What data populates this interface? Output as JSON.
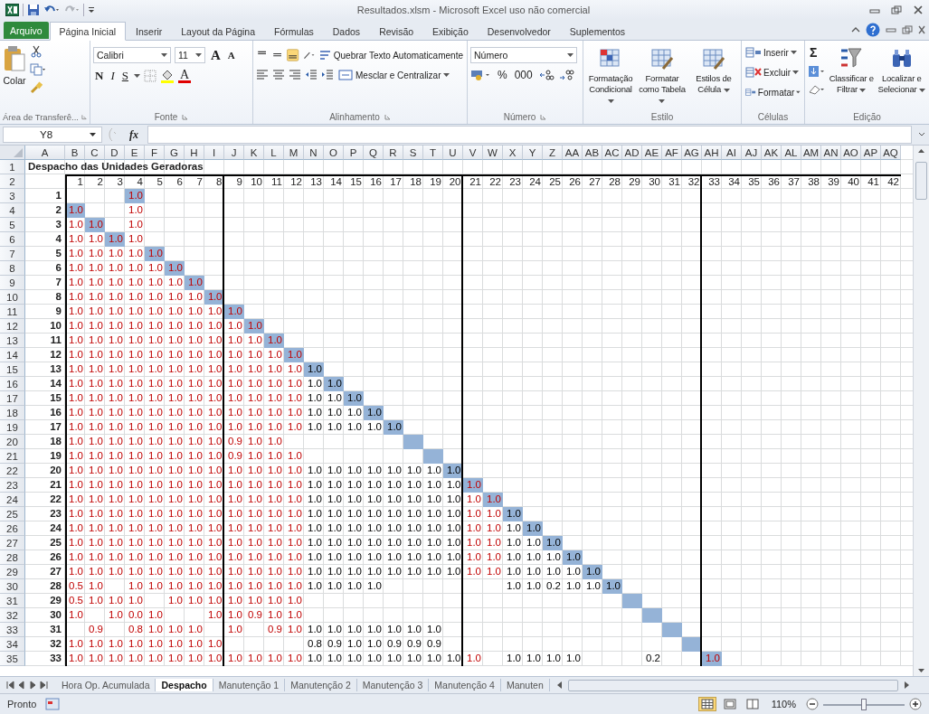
{
  "window": {
    "title": "Resultados.xlsm - Microsoft Excel uso não comercial"
  },
  "tabs": [
    {
      "label": "Arquivo",
      "kind": "file"
    },
    {
      "label": "Página Inicial",
      "kind": "tab",
      "selected": true
    },
    {
      "label": "Inserir",
      "kind": "tab",
      "selected": false
    },
    {
      "label": "Layout da Página",
      "kind": "tab",
      "selected": false
    },
    {
      "label": "Fórmulas",
      "kind": "tab",
      "selected": false
    },
    {
      "label": "Dados",
      "kind": "tab",
      "selected": false
    },
    {
      "label": "Revisão",
      "kind": "tab",
      "selected": false
    },
    {
      "label": "Exibição",
      "kind": "tab",
      "selected": false
    },
    {
      "label": "Desenvolvedor",
      "kind": "tab",
      "selected": false
    },
    {
      "label": "Suplementos",
      "kind": "tab",
      "selected": false
    }
  ],
  "ribbon": {
    "clipboard": {
      "paste": "Colar",
      "label": "Área de Transferê..."
    },
    "font": {
      "family": "Calibri",
      "size": "11",
      "grow": "A",
      "shrink": "A",
      "bold": "N",
      "italic": "I",
      "underline": "S",
      "font_color": "A",
      "label": "Fonte"
    },
    "alignment": {
      "vertical": [
        {
          "selected": false
        },
        {
          "selected": false
        },
        {
          "selected": true
        }
      ],
      "wrap": "Quebrar Texto Automaticamente",
      "merge": "Mesclar e Centralizar",
      "label": "Alinhamento"
    },
    "number": {
      "format": "Número",
      "percent": "%",
      "thousands": "000",
      "label": "Número"
    },
    "styles": {
      "buttons": [
        "Formatação Condicional",
        "Formatar como Tabela",
        "Estilos de Célula"
      ],
      "label": "Estilo"
    },
    "cells": {
      "buttons": [
        "Inserir",
        "Excluir",
        "Formatar"
      ],
      "label": "Células"
    },
    "editing": {
      "sum": "Σ",
      "buttons": [
        "Classificar e Filtrar",
        "Localizar e Selecionar"
      ],
      "label": "Edição"
    }
  },
  "formula_bar": {
    "name_box": "Y8",
    "function_label": "fx"
  },
  "column_headers": [
    "A",
    "B",
    "C",
    "D",
    "E",
    "F",
    "G",
    "H",
    "I",
    "J",
    "K",
    "L",
    "M",
    "N",
    "O",
    "P",
    "Q",
    "R",
    "S",
    "T",
    "U",
    "V",
    "W",
    "X",
    "Y",
    "Z",
    "AA",
    "AB",
    "AC",
    "AD",
    "AE",
    "AF",
    "AG",
    "AH",
    "AI",
    "AJ",
    "AK",
    "AL",
    "AM",
    "AN",
    "AO",
    "AP",
    "AQ"
  ],
  "title_row": {
    "row": "1",
    "text": "Despacho das Unidades Geradoras"
  },
  "unit_row": {
    "row": "2",
    "units": [
      {
        "number": "1",
        "kind": "red",
        "divider_after": false
      },
      {
        "number": "2",
        "kind": "red",
        "divider_after": false
      },
      {
        "number": "3",
        "kind": "red",
        "divider_after": false
      },
      {
        "number": "4",
        "kind": "red",
        "divider_after": false
      },
      {
        "number": "5",
        "kind": "red",
        "divider_after": false
      },
      {
        "number": "6",
        "kind": "red",
        "divider_after": false
      },
      {
        "number": "7",
        "kind": "red",
        "divider_after": false
      },
      {
        "number": "8",
        "kind": "red",
        "divider_after": true
      },
      {
        "number": "9",
        "kind": "red",
        "divider_after": false
      },
      {
        "number": "10",
        "kind": "red",
        "divider_after": false
      },
      {
        "number": "11",
        "kind": "red",
        "divider_after": false
      },
      {
        "number": "12",
        "kind": "red",
        "divider_after": false
      },
      {
        "number": "13",
        "kind": "black",
        "divider_after": false
      },
      {
        "number": "14",
        "kind": "black",
        "divider_after": false
      },
      {
        "number": "15",
        "kind": "black",
        "divider_after": false
      },
      {
        "number": "16",
        "kind": "black",
        "divider_after": false
      },
      {
        "number": "17",
        "kind": "black",
        "divider_after": false
      },
      {
        "number": "18",
        "kind": "black",
        "divider_after": false
      },
      {
        "number": "19",
        "kind": "black",
        "divider_after": false
      },
      {
        "number": "20",
        "kind": "black",
        "divider_after": true
      },
      {
        "number": "21",
        "kind": "red",
        "divider_after": false
      },
      {
        "number": "22",
        "kind": "red",
        "divider_after": false
      },
      {
        "number": "23",
        "kind": "black",
        "divider_after": false
      },
      {
        "number": "24",
        "kind": "black",
        "divider_after": false
      },
      {
        "number": "25",
        "kind": "black",
        "divider_after": false
      },
      {
        "number": "26",
        "kind": "black",
        "divider_after": false
      },
      {
        "number": "27",
        "kind": "black",
        "divider_after": false
      },
      {
        "number": "28",
        "kind": "black",
        "divider_after": false
      },
      {
        "number": "29",
        "divider_after": false
      },
      {
        "number": "30",
        "kind": "black",
        "divider_after": false
      },
      {
        "number": "31",
        "divider_after": false
      },
      {
        "number": "32",
        "divider_after": true
      },
      {
        "number": "33",
        "kind": "red",
        "divider_after": false
      },
      {
        "number": "34",
        "divider_after": false
      },
      {
        "number": "35",
        "divider_after": false
      },
      {
        "number": "36",
        "divider_after": false
      },
      {
        "number": "37",
        "divider_after": false
      },
      {
        "number": "38",
        "divider_after": false
      },
      {
        "number": "39",
        "divider_after": false
      },
      {
        "number": "40",
        "divider_after": false
      },
      {
        "number": "41",
        "divider_after": false
      },
      {
        "number": "42",
        "divider_after": false
      }
    ]
  },
  "rows": [
    {
      "row": "3",
      "unit": "1",
      "cells": [
        null,
        null,
        null,
        {
          "text": "1.0",
          "highlighted": true
        }
      ]
    },
    {
      "row": "4",
      "unit": "2",
      "cells": [
        {
          "text": "1.0",
          "highlighted": true
        },
        null,
        null,
        "1.0"
      ]
    },
    {
      "row": "5",
      "unit": "3",
      "cells": [
        "1.0",
        {
          "text": "1.0",
          "highlighted": true
        },
        null,
        "1.0"
      ]
    },
    {
      "row": "6",
      "unit": "4",
      "cells": [
        "1.0",
        "1.0",
        {
          "text": "1.0",
          "highlighted": true
        },
        "1.0"
      ]
    },
    {
      "row": "7",
      "unit": "5",
      "cells": [
        "1.0",
        "1.0",
        "1.0",
        "1.0",
        {
          "text": "1.0",
          "highlighted": true
        }
      ]
    },
    {
      "row": "8",
      "unit": "6",
      "cells": [
        "1.0",
        "1.0",
        "1.0",
        "1.0",
        "1.0",
        {
          "text": "1.0",
          "highlighted": true
        }
      ]
    },
    {
      "row": "9",
      "unit": "7",
      "cells": [
        "1.0",
        "1.0",
        "1.0",
        "1.0",
        "1.0",
        "1.0",
        {
          "text": "1.0",
          "highlighted": true
        }
      ]
    },
    {
      "row": "10",
      "unit": "8",
      "cells": [
        "1.0",
        "1.0",
        "1.0",
        "1.0",
        "1.0",
        "1.0",
        "1.0",
        {
          "text": "1.0",
          "highlighted": true
        }
      ]
    },
    {
      "row": "11",
      "unit": "9",
      "cells": [
        "1.0",
        "1.0",
        "1.0",
        "1.0",
        "1.0",
        "1.0",
        "1.0",
        "1.0",
        {
          "text": "1.0",
          "highlighted": true
        }
      ]
    },
    {
      "row": "12",
      "unit": "10",
      "cells": [
        "1.0",
        "1.0",
        "1.0",
        "1.0",
        "1.0",
        "1.0",
        "1.0",
        "1.0",
        "1.0",
        {
          "text": "1.0",
          "highlighted": true
        }
      ]
    },
    {
      "row": "13",
      "unit": "11",
      "cells": [
        "1.0",
        "1.0",
        "1.0",
        "1.0",
        "1.0",
        "1.0",
        "1.0",
        "1.0",
        "1.0",
        "1.0",
        {
          "text": "1.0",
          "highlighted": true
        }
      ]
    },
    {
      "row": "14",
      "unit": "12",
      "cells": [
        "1.0",
        "1.0",
        "1.0",
        "1.0",
        "1.0",
        "1.0",
        "1.0",
        "1.0",
        "1.0",
        "1.0",
        "1.0",
        {
          "text": "1.0",
          "highlighted": true
        }
      ]
    },
    {
      "row": "15",
      "unit": "13",
      "cells": [
        "1.0",
        "1.0",
        "1.0",
        "1.0",
        "1.0",
        "1.0",
        "1.0",
        "1.0",
        "1.0",
        "1.0",
        "1.0",
        "1.0",
        {
          "text": "1.0",
          "highlighted": true
        }
      ]
    },
    {
      "row": "16",
      "unit": "14",
      "cells": [
        "1.0",
        "1.0",
        "1.0",
        "1.0",
        "1.0",
        "1.0",
        "1.0",
        "1.0",
        "1.0",
        "1.0",
        "1.0",
        "1.0",
        "1.0",
        {
          "text": "1.0",
          "highlighted": true
        }
      ]
    },
    {
      "row": "17",
      "unit": "15",
      "cells": [
        "1.0",
        "1.0",
        "1.0",
        "1.0",
        "1.0",
        "1.0",
        "1.0",
        "1.0",
        "1.0",
        "1.0",
        "1.0",
        "1.0",
        "1.0",
        "1.0",
        {
          "text": "1.0",
          "highlighted": true
        }
      ]
    },
    {
      "row": "18",
      "unit": "16",
      "cells": [
        "1.0",
        "1.0",
        "1.0",
        "1.0",
        "1.0",
        "1.0",
        "1.0",
        "1.0",
        "1.0",
        "1.0",
        "1.0",
        "1.0",
        "1.0",
        "1.0",
        "1.0",
        {
          "text": "1.0",
          "highlighted": true
        }
      ]
    },
    {
      "row": "19",
      "unit": "17",
      "cells": [
        "1.0",
        "1.0",
        "1.0",
        "1.0",
        "1.0",
        "1.0",
        "1.0",
        "1.0",
        "1.0",
        "1.0",
        "1.0",
        "1.0",
        "1.0",
        "1.0",
        "1.0",
        "1.0",
        {
          "text": "1.0",
          "highlighted": true
        }
      ]
    },
    {
      "row": "20",
      "unit": "18",
      "cells": [
        "1.0",
        "1.0",
        "1.0",
        "1.0",
        "1.0",
        "1.0",
        "1.0",
        "1.0",
        "0.9",
        "1.0",
        "1.0",
        null,
        null,
        null,
        null,
        null,
        null,
        {
          "highlighted": true
        }
      ]
    },
    {
      "row": "21",
      "unit": "19",
      "cells": [
        "1.0",
        "1.0",
        "1.0",
        "1.0",
        "1.0",
        "1.0",
        "1.0",
        "1.0",
        "0.9",
        "1.0",
        "1.0",
        "1.0",
        null,
        null,
        null,
        null,
        null,
        null,
        {
          "highlighted": true
        }
      ]
    },
    {
      "row": "22",
      "unit": "20",
      "cells": [
        "1.0",
        "1.0",
        "1.0",
        "1.0",
        "1.0",
        "1.0",
        "1.0",
        "1.0",
        "1.0",
        "1.0",
        "1.0",
        "1.0",
        "1.0",
        "1.0",
        "1.0",
        "1.0",
        "1.0",
        "1.0",
        "1.0",
        {
          "text": "1.0",
          "highlighted": true
        }
      ]
    },
    {
      "row": "23",
      "unit": "21",
      "cells": [
        "1.0",
        "1.0",
        "1.0",
        "1.0",
        "1.0",
        "1.0",
        "1.0",
        "1.0",
        "1.0",
        "1.0",
        "1.0",
        "1.0",
        "1.0",
        "1.0",
        "1.0",
        "1.0",
        "1.0",
        "1.0",
        "1.0",
        "1.0",
        {
          "text": "1.0",
          "highlighted": true
        }
      ]
    },
    {
      "row": "24",
      "unit": "22",
      "cells": [
        "1.0",
        "1.0",
        "1.0",
        "1.0",
        "1.0",
        "1.0",
        "1.0",
        "1.0",
        "1.0",
        "1.0",
        "1.0",
        "1.0",
        "1.0",
        "1.0",
        "1.0",
        "1.0",
        "1.0",
        "1.0",
        "1.0",
        "1.0",
        "1.0",
        {
          "text": "1.0",
          "highlighted": true
        }
      ]
    },
    {
      "row": "25",
      "unit": "23",
      "cells": [
        "1.0",
        "1.0",
        "1.0",
        "1.0",
        "1.0",
        "1.0",
        "1.0",
        "1.0",
        "1.0",
        "1.0",
        "1.0",
        "1.0",
        "1.0",
        "1.0",
        "1.0",
        "1.0",
        "1.0",
        "1.0",
        "1.0",
        "1.0",
        "1.0",
        "1.0",
        {
          "text": "1.0",
          "highlighted": true
        }
      ]
    },
    {
      "row": "26",
      "unit": "24",
      "cells": [
        "1.0",
        "1.0",
        "1.0",
        "1.0",
        "1.0",
        "1.0",
        "1.0",
        "1.0",
        "1.0",
        "1.0",
        "1.0",
        "1.0",
        "1.0",
        "1.0",
        "1.0",
        "1.0",
        "1.0",
        "1.0",
        "1.0",
        "1.0",
        "1.0",
        "1.0",
        "1.0",
        {
          "text": "1.0",
          "highlighted": true
        }
      ]
    },
    {
      "row": "27",
      "unit": "25",
      "cells": [
        "1.0",
        "1.0",
        "1.0",
        "1.0",
        "1.0",
        "1.0",
        "1.0",
        "1.0",
        "1.0",
        "1.0",
        "1.0",
        "1.0",
        "1.0",
        "1.0",
        "1.0",
        "1.0",
        "1.0",
        "1.0",
        "1.0",
        "1.0",
        "1.0",
        "1.0",
        "1.0",
        "1.0",
        {
          "text": "1.0",
          "highlighted": true
        }
      ]
    },
    {
      "row": "28",
      "unit": "26",
      "cells": [
        "1.0",
        "1.0",
        "1.0",
        "1.0",
        "1.0",
        "1.0",
        "1.0",
        "1.0",
        "1.0",
        "1.0",
        "1.0",
        "1.0",
        "1.0",
        "1.0",
        "1.0",
        "1.0",
        "1.0",
        "1.0",
        "1.0",
        "1.0",
        "1.0",
        "1.0",
        "1.0",
        "1.0",
        "1.0",
        {
          "text": "1.0",
          "highlighted": true
        }
      ]
    },
    {
      "row": "29",
      "unit": "27",
      "cells": [
        "1.0",
        "1.0",
        "1.0",
        "1.0",
        "1.0",
        "1.0",
        "1.0",
        "1.0",
        "1.0",
        "1.0",
        "1.0",
        "1.0",
        "1.0",
        "1.0",
        "1.0",
        "1.0",
        "1.0",
        "1.0",
        "1.0",
        "1.0",
        "1.0",
        "1.0",
        "1.0",
        "1.0",
        "1.0",
        "1.0",
        {
          "text": "1.0",
          "highlighted": true
        }
      ]
    },
    {
      "row": "30",
      "unit": "28",
      "cells": [
        "0.5",
        "1.0",
        null,
        "1.0",
        "1.0",
        "1.0",
        "1.0",
        "1.0",
        "1.0",
        "1.0",
        "1.0",
        "1.0",
        "1.0",
        "1.0",
        "1.0",
        "1.0",
        null,
        null,
        null,
        null,
        null,
        null,
        "1.0",
        "1.0",
        "0.2",
        "1.0",
        "1.0",
        {
          "text": "1.0",
          "highlighted": true
        }
      ]
    },
    {
      "row": "31",
      "unit": "29",
      "cells": [
        "0.5",
        "1.0",
        "1.0",
        "1.0",
        null,
        "1.0",
        "1.0",
        "1.0",
        "1.0",
        "1.0",
        "1.0",
        "1.0",
        null,
        null,
        null,
        null,
        null,
        null,
        null,
        null,
        null,
        null,
        null,
        null,
        null,
        null,
        null,
        null,
        {
          "highlighted": true
        }
      ]
    },
    {
      "row": "32",
      "unit": "30",
      "cells": [
        "1.0",
        null,
        "1.0",
        "0.0",
        "1.0",
        null,
        null,
        "1.0",
        "1.0",
        "0.9",
        "1.0",
        "1.0",
        null,
        null,
        null,
        null,
        null,
        null,
        null,
        null,
        null,
        null,
        null,
        null,
        null,
        null,
        null,
        null,
        null,
        {
          "highlighted": true
        }
      ]
    },
    {
      "row": "33",
      "unit": "31",
      "cells": [
        null,
        "0.9",
        null,
        "0.8",
        "1.0",
        "1.0",
        "1.0",
        null,
        "1.0",
        null,
        "0.9",
        "1.0",
        "1.0",
        "1.0",
        "1.0",
        "1.0",
        "1.0",
        "1.0",
        "1.0",
        null,
        null,
        null,
        null,
        null,
        null,
        null,
        null,
        null,
        null,
        null,
        {
          "highlighted": true
        }
      ]
    },
    {
      "row": "34",
      "unit": "32",
      "cells": [
        "1.0",
        "1.0",
        "1.0",
        "1.0",
        "1.0",
        "1.0",
        "1.0",
        "1.0",
        null,
        null,
        null,
        null,
        "0.8",
        "0.9",
        "1.0",
        "1.0",
        "0.9",
        "0.9",
        "0.9",
        null,
        null,
        null,
        null,
        null,
        null,
        null,
        null,
        null,
        null,
        null,
        null,
        {
          "highlighted": true
        }
      ]
    },
    {
      "row": "35",
      "unit": "33",
      "cells": [
        "1.0",
        "1.0",
        "1.0",
        "1.0",
        "1.0",
        "1.0",
        "1.0",
        "1.0",
        "1.0",
        "1.0",
        "1.0",
        "1.0",
        "1.0",
        "1.0",
        "1.0",
        "1.0",
        "1.0",
        "1.0",
        "1.0",
        "1.0",
        "1.0",
        null,
        "1.0",
        "1.0",
        "1.0",
        "1.0",
        null,
        null,
        null,
        "0.2",
        null,
        null,
        {
          "text": "1.0",
          "highlighted": true
        }
      ]
    }
  ],
  "sheet_tabs": [
    {
      "label": "Hora Op. Acumulada",
      "selected": false
    },
    {
      "label": "Despacho",
      "selected": true
    },
    {
      "label": "Manutenção 1",
      "selected": false
    },
    {
      "label": "Manutenção 2",
      "selected": false
    },
    {
      "label": "Manutenção 3",
      "selected": false
    },
    {
      "label": "Manutenção 4",
      "selected": false
    },
    {
      "label": "Manuten",
      "selected": false
    }
  ],
  "status_bar": {
    "status": "Pronto",
    "views": [
      {
        "selected": true
      },
      {
        "selected": false
      },
      {
        "selected": false
      }
    ],
    "zoom": "110%",
    "zoom_slider": {
      "level": 0.5
    }
  }
}
